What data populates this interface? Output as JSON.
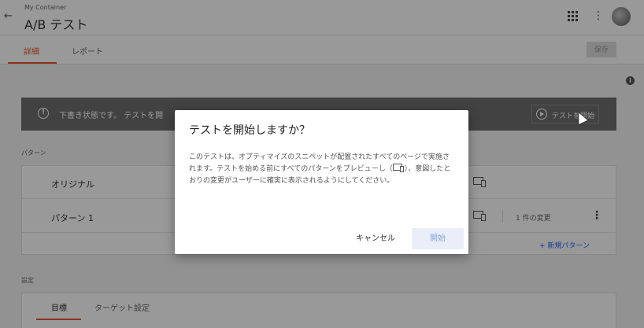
{
  "header": {
    "back_icon": "arrow-left-icon",
    "container": "My Container",
    "title": "A/B テスト"
  },
  "tabs": {
    "details": "詳細",
    "reports": "レポート",
    "save_label": "保存"
  },
  "banner": {
    "text": "下書き状態です。 テストを開",
    "start_label": "テストを開始"
  },
  "variants": {
    "section_label": "パターン",
    "rows": [
      {
        "name": "オリジナル"
      },
      {
        "name": "パターン 1",
        "changes": "1 件の変更"
      }
    ],
    "new_variant": "+ 新規パターン"
  },
  "settings": {
    "section_label": "設定",
    "tabs": [
      "目標",
      "ターゲット設定"
    ]
  },
  "dialog": {
    "title": "テストを開始しますか？",
    "body_1": "このテストは、オプティマイズのスニペットが配置されたすべてのページで実施されます。テストを始める前にすべてのパターンをプレビューし（",
    "body_2": "）、意図したとおりの変更がユーザーに確実に表示されるようにしてください。",
    "cancel": "キャンセル",
    "start": "開始"
  },
  "colors": {
    "accent": "#e8562a",
    "link": "#2962ff",
    "banner": "#6e6e6e"
  }
}
